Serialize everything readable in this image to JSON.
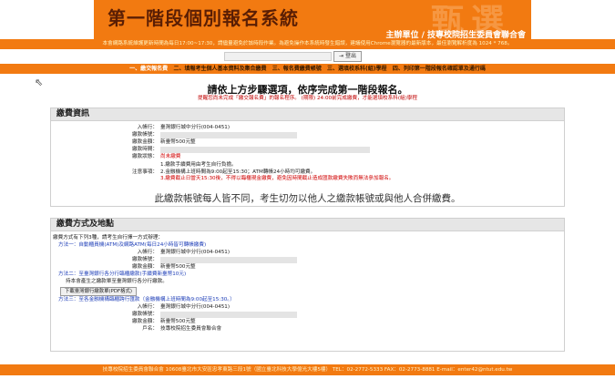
{
  "header": {
    "title": "第一階段個別報名系統",
    "watermark": "甄選",
    "org": "主辦單位 / 技專校院招生委員會聯合會"
  },
  "notice": "本會網路系統維護更新時間為每日17:00~17:30，請儘量避免於該時段作業。為避免操作本系統時發生錯誤，建議使用Chrome瀏覽器的最新版本，最佳瀏覽解析度為 1024 * 768。",
  "login": {
    "logout_label": "登出"
  },
  "nav": [
    {
      "label": "一、繳交報名費",
      "active": true
    },
    {
      "label": "二、填報考生個人基本資料及集合繳費",
      "active": false
    },
    {
      "label": "三、報名費繳費帳號",
      "active": false
    },
    {
      "label": "三、選填校系科(組)學程",
      "active": false
    },
    {
      "label": "四、列印第一階段報名確認單及通行碼",
      "active": false
    }
  ],
  "step": {
    "title": "請依上方步驟選項，依序完成第一階段報名。",
    "subtitle": "提醒您尚未完成「繳交報名費」的報名程序。                    (期限) 24:00前完成繳費，才能選填校系科(組)學程"
  },
  "pay_info": {
    "heading": "繳費資訊",
    "rows": [
      {
        "label": "入帳行：",
        "value": "臺灣銀行城中分行(004-0451)",
        "style": ""
      },
      {
        "label": "繳款帳號：",
        "value": "",
        "style": "bar"
      },
      {
        "label": "繳款金額：",
        "value": "新臺幣500元整",
        "style": ""
      },
      {
        "label": "繳款時間：",
        "value": "",
        "style": "bar"
      },
      {
        "label": "繳款狀態：",
        "value": "尚未繳費",
        "style": "red"
      }
    ],
    "notes_label": "注意事項：",
    "notes": [
      "1.繳款手續費用由考生自行負擔。",
      "2.金融機構上班時間為9:00起至15:30；ATM轉帳24小時均可繳費。",
      "3.繳費截止日當天15:30後，不得以臨櫃現金繳費，避免因時間截止造成匯款繳費失敗而無法參加報名。"
    ],
    "warning": "此繳款帳號每人皆不同，考生切勿以他人之繳款帳號或與他人合併繳費。"
  },
  "pay_method": {
    "heading": "繳費方式及地點",
    "intro": "繳費方式有下列3種，請考生自行擇一方式辦理：",
    "method1": {
      "title": "方法一：自動櫃員機(ATM)及網路ATM(每日24小時皆可轉帳繳費)",
      "rows": [
        {
          "label": "入帳行：",
          "value": "臺灣銀行城中分行(004-0451)"
        },
        {
          "label": "繳款帳號：",
          "value": ""
        },
        {
          "label": "繳款金額：",
          "value": "新臺幣500元整"
        }
      ]
    },
    "method2": {
      "title": "方法二：至臺灣銀行各分行臨櫃繳款(手續費新臺幣10元)",
      "desc": "持本會產生之繳款單至臺灣銀行各分行繳款。",
      "button": "下載臺灣銀行繳款單(PDF格式)"
    },
    "method3": {
      "title": "方法三：至各金融機構臨櫃跨行匯款（金融機構上班時間為9:00起至15:30。）",
      "rows": [
        {
          "label": "入帳行：",
          "value": "臺灣銀行城中分行(004-0451)"
        },
        {
          "label": "繳款帳號：",
          "value": ""
        },
        {
          "label": "繳款金額：",
          "value": "新臺幣500元整"
        },
        {
          "label": "戶名：",
          "value": "技專校院招生委員會聯合會"
        }
      ]
    }
  },
  "footer": "技專校院招生委員會聯合會 10608臺北市大安區忠孝東路三段1號（國立臺北科技大學億光大樓5樓） TEL：02-2772-5333 FAX：02-2773-8881 E-mail：enter42@ntut.edu.tw",
  "colors": {
    "brand_orange": "#f27a11",
    "alert_red": "#d00000",
    "link_blue": "#1f3fb8"
  }
}
